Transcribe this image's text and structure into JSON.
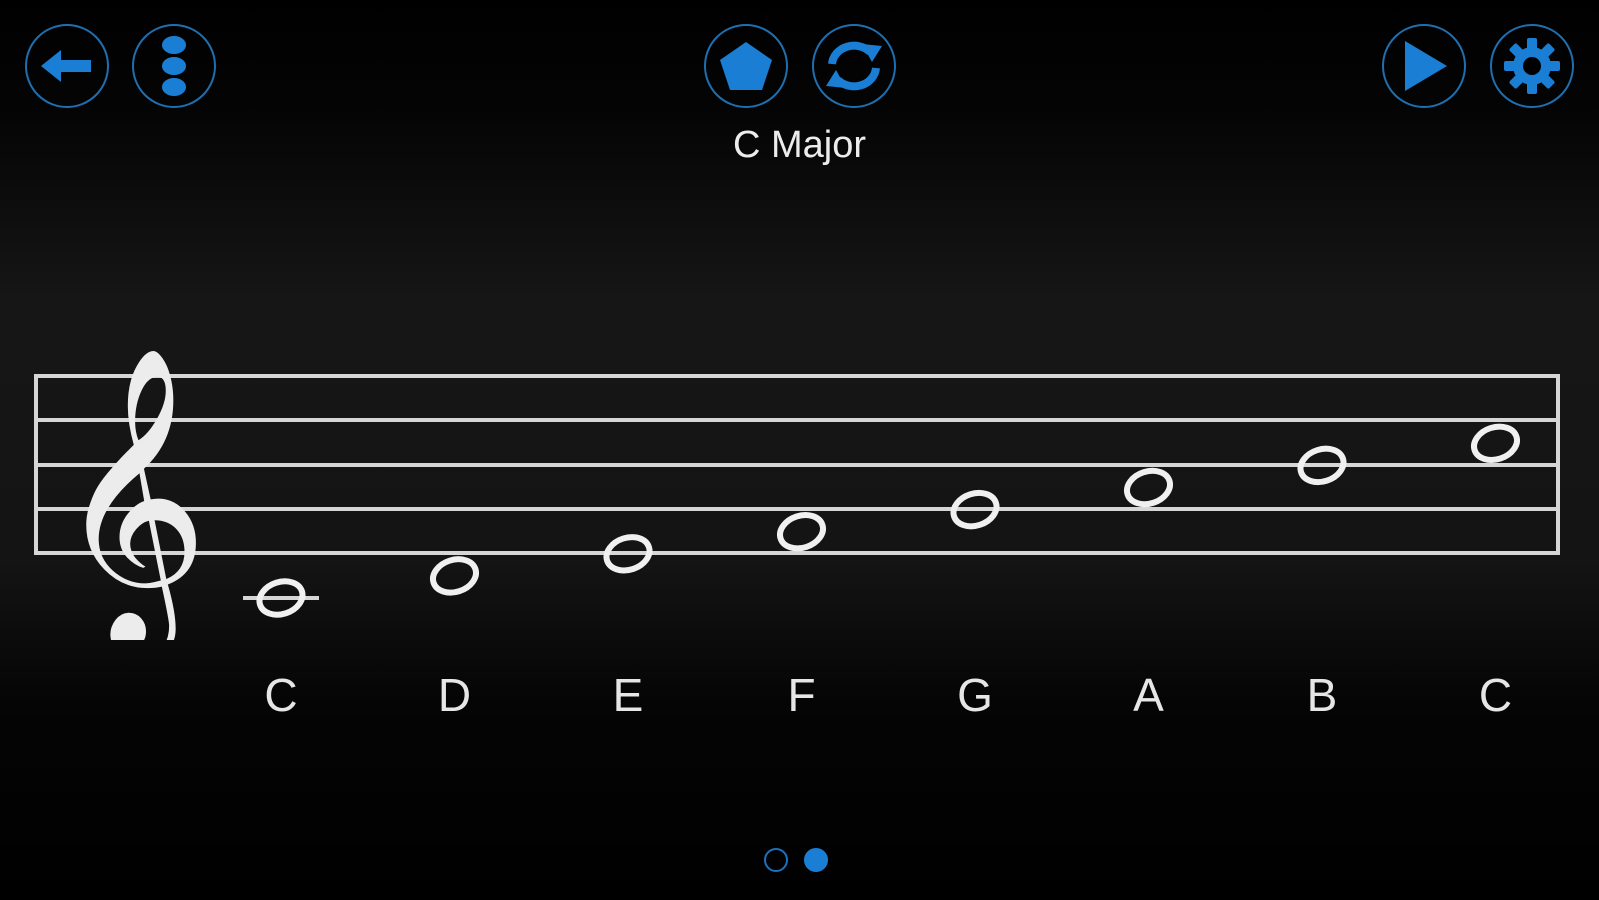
{
  "toolbar": {
    "back": "back-arrow-icon",
    "menu": "vertical-dots-icon",
    "shape": "pentagon-icon",
    "refresh": "refresh-icon",
    "play": "play-icon",
    "settings": "gear-icon"
  },
  "scale": {
    "title": "C Major"
  },
  "notes": [
    {
      "label": "C"
    },
    {
      "label": "D"
    },
    {
      "label": "E"
    },
    {
      "label": "F"
    },
    {
      "label": "G"
    },
    {
      "label": "A"
    },
    {
      "label": "B"
    },
    {
      "label": "C"
    }
  ],
  "pagination": {
    "total": 2,
    "current": 2
  },
  "colors": {
    "accent": "#1a7fd4",
    "ring": "#1f6fb0",
    "staff": "#d6d6d6"
  }
}
